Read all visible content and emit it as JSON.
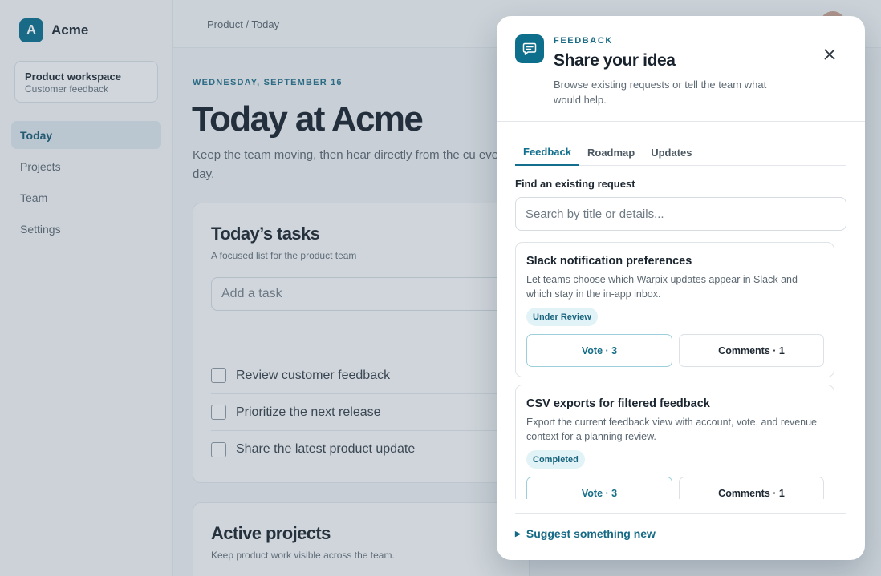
{
  "app": {
    "brand_initial": "A",
    "brand_name": "Acme"
  },
  "workspace": {
    "title": "Product workspace",
    "subtitle": "Customer feedback"
  },
  "nav": [
    {
      "label": "Today",
      "active": true
    },
    {
      "label": "Projects"
    },
    {
      "label": "Team"
    },
    {
      "label": "Settings"
    }
  ],
  "breadcrumb": "Product / Today",
  "main": {
    "date": "WEDNESDAY, SEPTEMBER 16",
    "title": "Today at Acme",
    "intro": "Keep the team moving, then hear directly from the cu every day."
  },
  "tasks_card": {
    "title": "Today’s tasks",
    "subtitle": "A focused list for the product team",
    "input_placeholder": "Add a task",
    "items": [
      "Review customer feedback",
      "Prioritize the next release",
      "Share the latest product update"
    ]
  },
  "projects_card": {
    "title": "Active projects",
    "subtitle": "Keep product work visible across the team."
  },
  "modal": {
    "eyebrow": "FEEDBACK",
    "title": "Share your idea",
    "description": "Browse existing requests or tell the team what would help.",
    "tabs": [
      "Feedback",
      "Roadmap",
      "Updates"
    ],
    "active_tab": "Feedback",
    "find_label": "Find an existing request",
    "search_placeholder": "Search by title or details...",
    "requests": [
      {
        "title": "Slack notification preferences",
        "description": "Let teams choose which Warpix updates appear in Slack and which stay in the in-app inbox.",
        "status": "Under Review",
        "vote_label": "Vote · 3",
        "comments_label": "Comments · 1"
      },
      {
        "title": "CSV exports for filtered feedback",
        "description": "Export the current feedback view with account, vote, and revenue context for a planning review.",
        "status": "Completed",
        "vote_label": "Vote · 3",
        "comments_label": "Comments · 1"
      }
    ],
    "suggest_label": "Suggest something new"
  },
  "colors": {
    "accent": "#0e6f8c",
    "badge_bg": "#e2f3f7"
  },
  "icons": [
    "chat-icon",
    "close-icon",
    "triangle-right-icon"
  ]
}
